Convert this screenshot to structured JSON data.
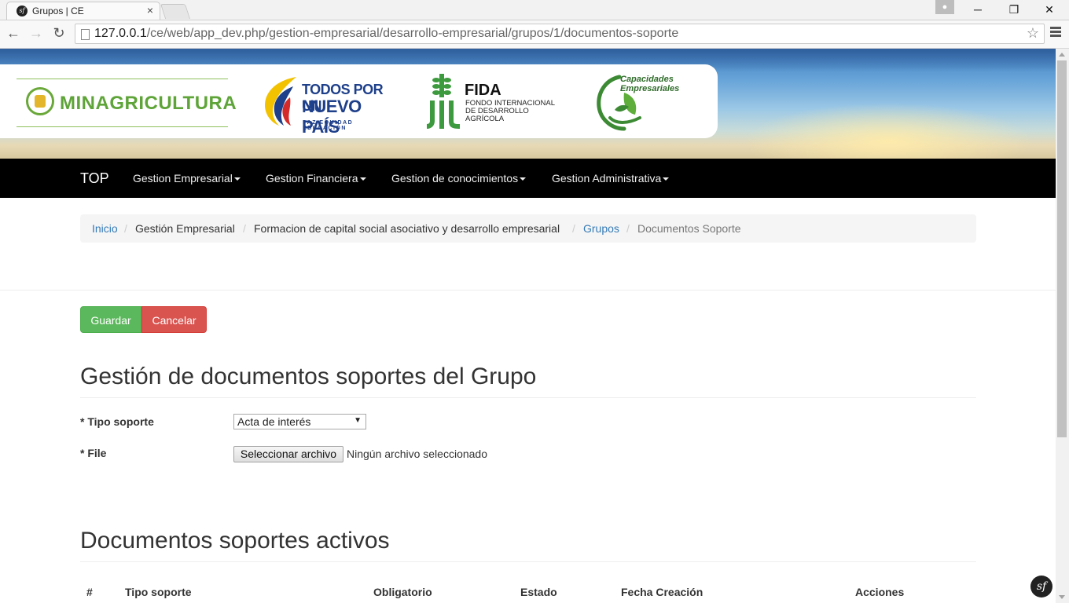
{
  "browser": {
    "tab_title": "Grupos | CE",
    "tab_icon_glyph": "sf",
    "tab_close": "×",
    "url_host": "127.0.0.1",
    "url_path": "/ce/web/app_dev.php/gestion-empresarial/desarrollo-empresarial/grupos/1/documentos-soporte",
    "back_glyph": "←",
    "forward_glyph": "→",
    "reload_glyph": "↻",
    "star_glyph": "☆",
    "minimize_glyph": "─",
    "restore_glyph": "❐",
    "close_glyph": "✕"
  },
  "logos": {
    "minagricultura": "MINAGRICULTURA",
    "todos_line1": "TODOS POR UN",
    "todos_line2": "NUEVO PAÍS",
    "todos_line3": "PAZ  EQUIDAD  EDUCACIÓN",
    "fida_title": "FIDA",
    "fida_subtitle_1": "Fondo Internacional",
    "fida_subtitle_2": "de Desarrollo",
    "fida_subtitle_3": "Agrícola",
    "cap_line1": "Capacidades",
    "cap_line2": "Empresariales"
  },
  "navbar": {
    "brand": "TOP",
    "items": [
      {
        "label": "Gestion Empresarial"
      },
      {
        "label": "Gestion Financiera"
      },
      {
        "label": "Gestion de conocimientos"
      },
      {
        "label": "Gestion Administrativa"
      }
    ]
  },
  "breadcrumb": {
    "items": [
      {
        "label": "Inicio"
      },
      {
        "label": "Gestión Empresarial"
      },
      {
        "label": "Formacion de capital social asociativo y desarrollo empresarial"
      },
      {
        "label": "Grupos"
      },
      {
        "label": "Documentos Soporte"
      }
    ],
    "separator": "/"
  },
  "actions": {
    "save_label": "Guardar",
    "cancel_label": "Cancelar"
  },
  "form": {
    "title": "Gestión de documentos soportes del Grupo",
    "tipo_soporte_label": "* Tipo soporte",
    "tipo_soporte_value": "Acta de interés",
    "file_label": "* File",
    "file_button": "Seleccionar archivo",
    "file_status": "Ningún archivo seleccionado"
  },
  "table": {
    "title": "Documentos soportes activos",
    "columns": [
      "#",
      "Tipo soporte",
      "Obligatorio",
      "Estado",
      "Fecha Creación",
      "Acciones"
    ]
  },
  "debug_toolbar_glyph": "sf",
  "colors": {
    "save": "#5cb85c",
    "cancel": "#d9534f",
    "link": "#337ab7",
    "navbar": "#000000",
    "minagri_green": "#5ea438",
    "todos_blue": "#1e3f8a"
  }
}
